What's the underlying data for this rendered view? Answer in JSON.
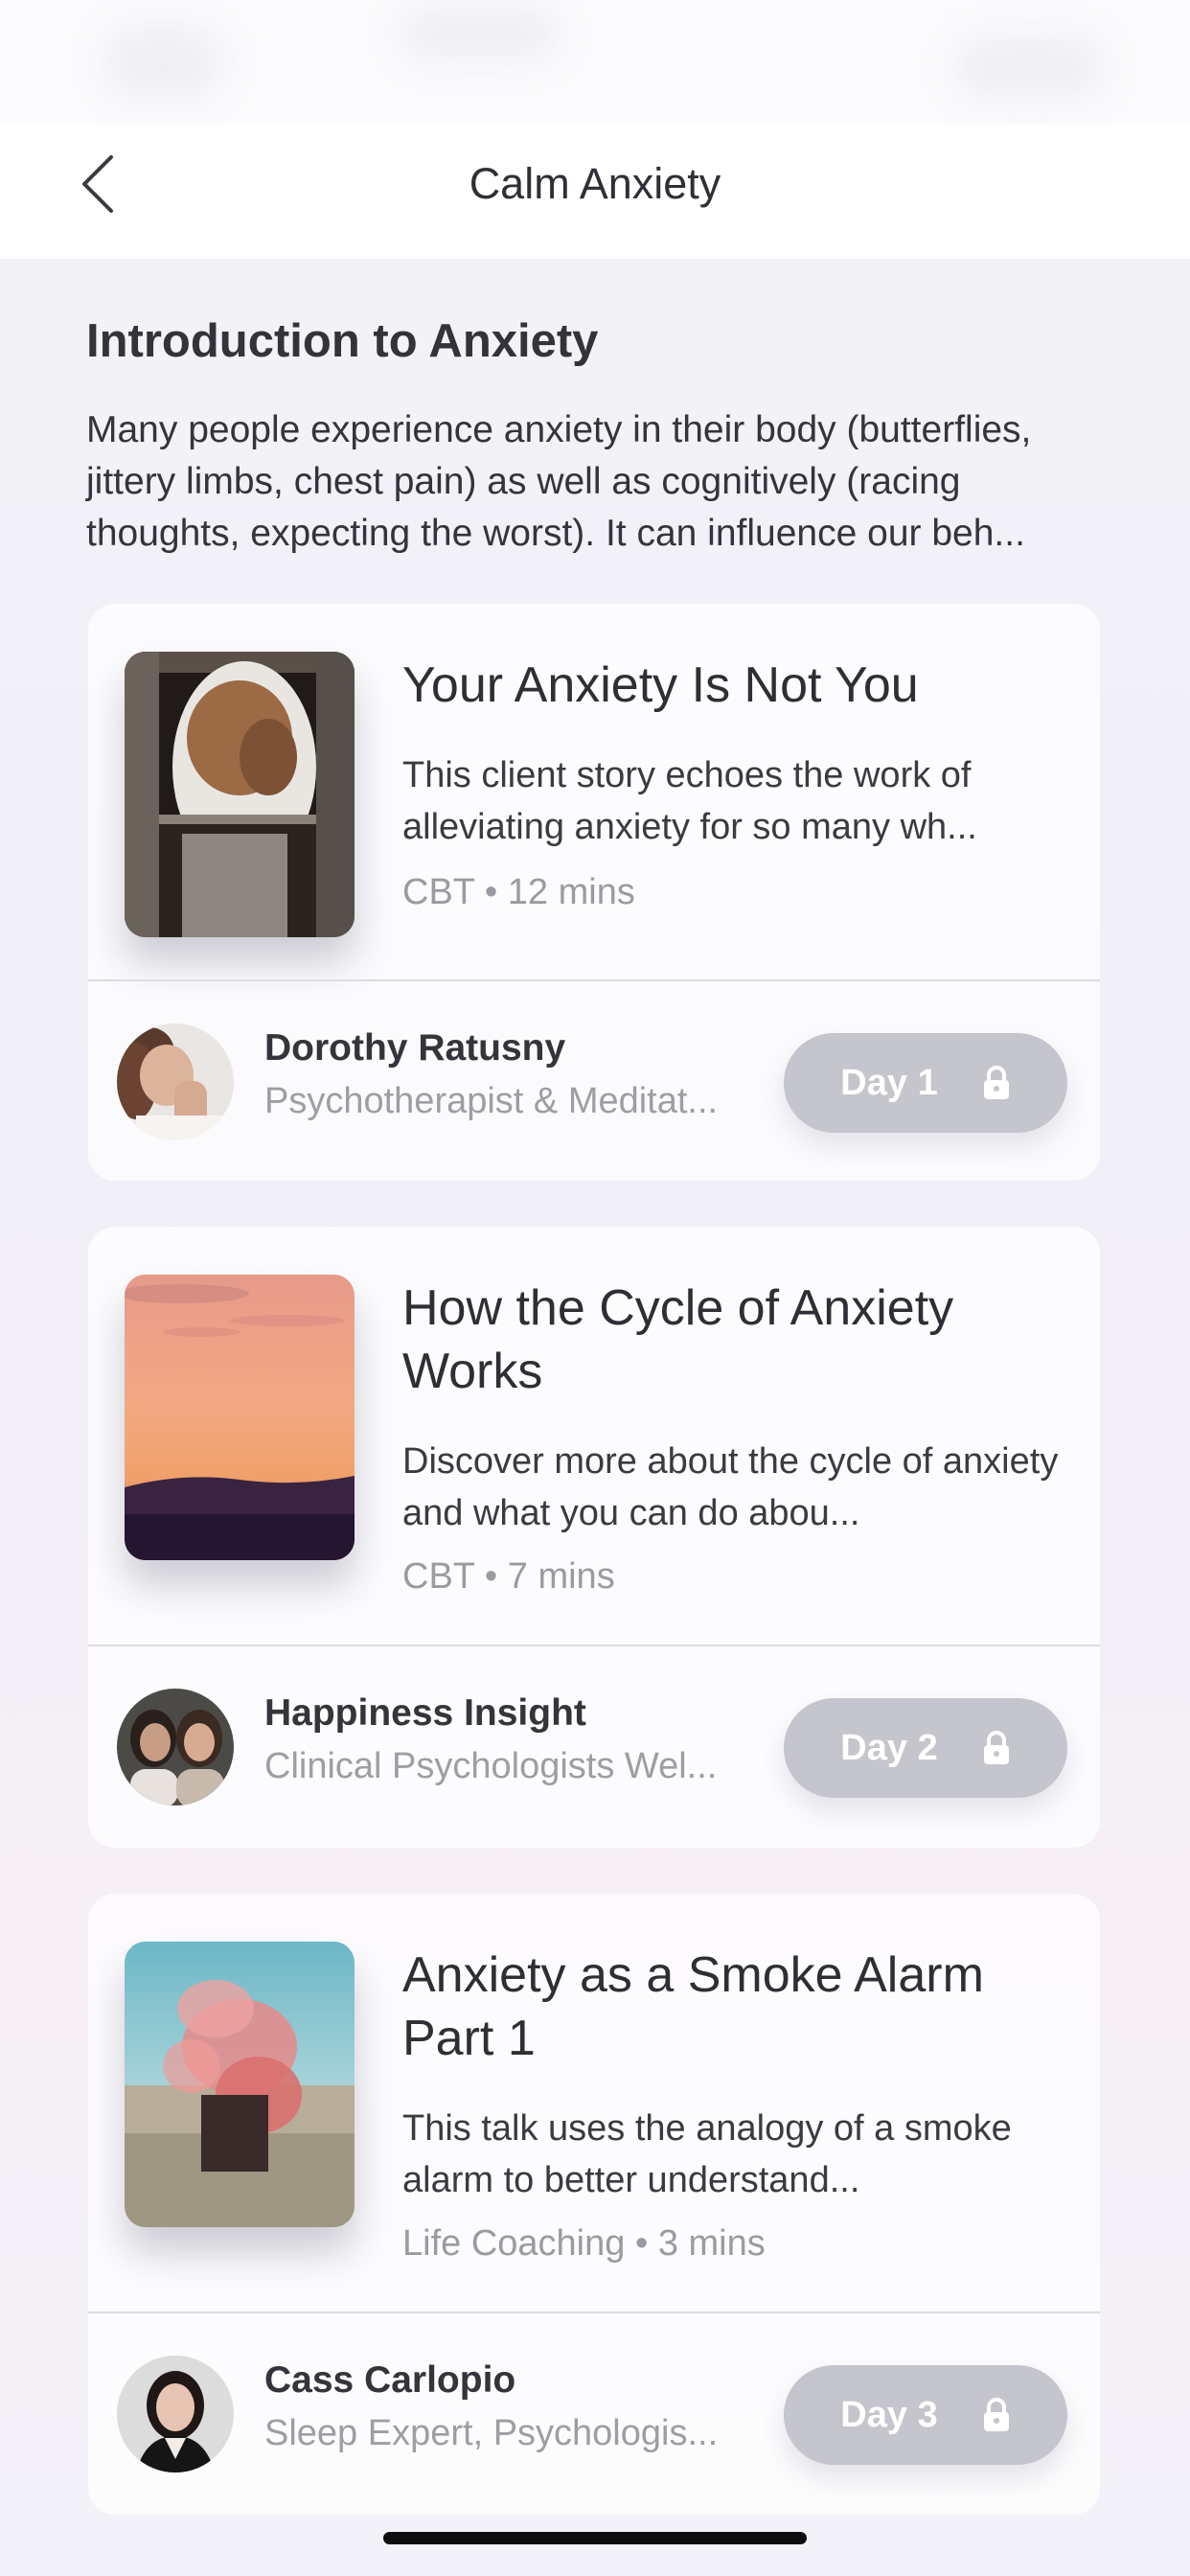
{
  "nav": {
    "title": "Calm Anxiety"
  },
  "intro": {
    "title": "Introduction to Anxiety",
    "description": "Many people experience anxiety in their body (butterflies, jittery limbs, chest pain) as well as cognitively (racing thoughts, expecting the worst). It can influence our beh..."
  },
  "cards": [
    {
      "title": "Your Anxiety Is Not You",
      "description": "This client story echoes the work of alleviating anxiety for so many wh...",
      "category": "CBT",
      "duration": "12 mins",
      "author_name": "Dorothy Ratusny",
      "author_role": "Psychotherapist & Meditat...",
      "day_label": "Day 1"
    },
    {
      "title": "How the Cycle of Anxiety Works",
      "description": "Discover more about the cycle of anxiety and what you can do abou...",
      "category": "CBT",
      "duration": "7 mins",
      "author_name": "Happiness Insight",
      "author_role": "Clinical Psychologists Wel...",
      "day_label": "Day 2"
    },
    {
      "title": "Anxiety as a Smoke Alarm Part 1",
      "description": "This talk uses the analogy of a smoke alarm to better understand...",
      "category": "Life Coaching",
      "duration": "3 mins",
      "author_name": "Cass Carlopio",
      "author_role": "Sleep Expert, Psychologis...",
      "day_label": "Day 3"
    }
  ],
  "icons": {
    "back": "chevron-left-icon",
    "lock": "lock-icon"
  },
  "colors": {
    "day_button": "#c5c5cd",
    "meta_text": "#9a9aa2"
  }
}
